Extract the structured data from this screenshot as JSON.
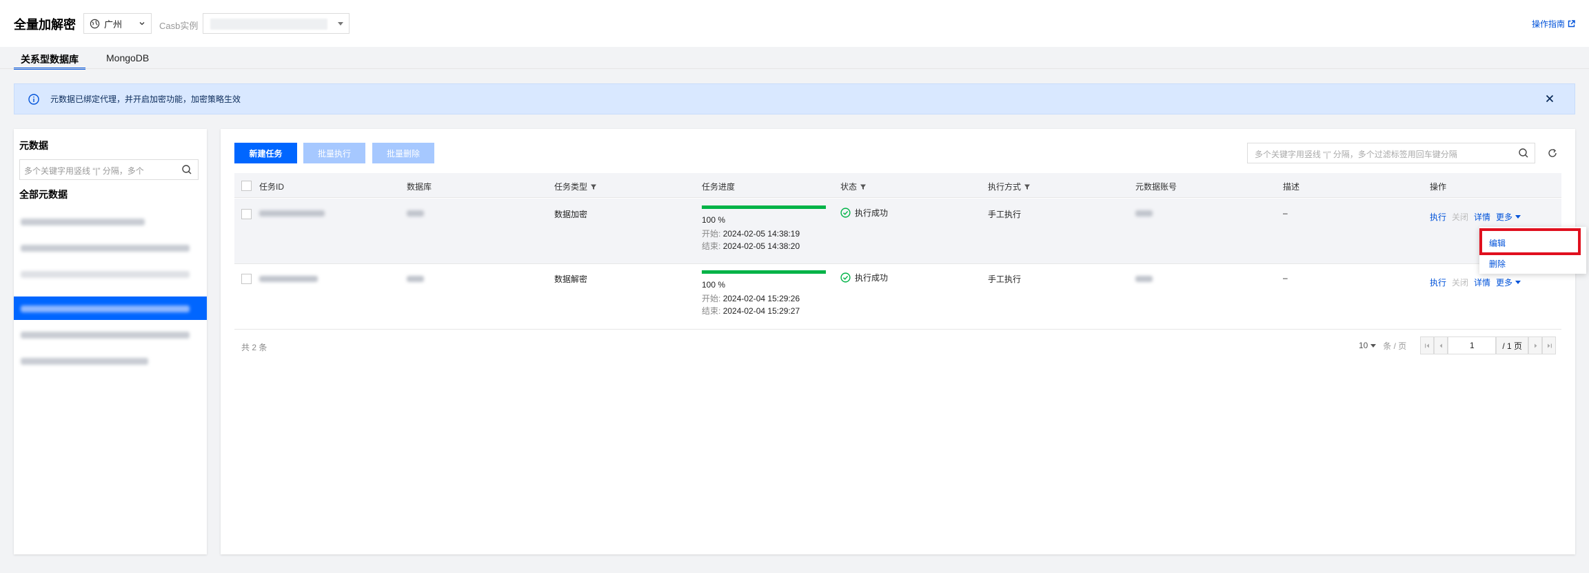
{
  "header": {
    "title": "全量加解密",
    "region": "广州",
    "casb_label": "Casb实例",
    "guide_link": "操作指南"
  },
  "tabs": [
    {
      "label": "关系型数据库",
      "active": true
    },
    {
      "label": "MongoDB",
      "active": false
    }
  ],
  "notice": {
    "text": "元数据已绑定代理，并开启加密功能，加密策略生效"
  },
  "left_panel": {
    "title": "元数据",
    "search_placeholder": "多个关键字用竖线 “|” 分隔，多个",
    "all_label": "全部元数据"
  },
  "toolbar": {
    "new_task": "新建任务",
    "batch_execute": "批量执行",
    "batch_delete": "批量删除",
    "search_placeholder": "多个关键字用竖线 “|” 分隔，多个过滤标签用回车键分隔"
  },
  "table": {
    "headers": {
      "task_id": "任务ID",
      "database": "数据库",
      "task_type": "任务类型",
      "progress": "任务进度",
      "status": "状态",
      "exec_mode": "执行方式",
      "meta_account": "元数据账号",
      "description": "描述",
      "operations": "操作"
    },
    "rows": [
      {
        "task_type": "数据加密",
        "progress_pct": 100,
        "progress_text": "100 %",
        "start_label": "开始:",
        "start_time": "2024-02-05 14:38:19",
        "end_label": "结束:",
        "end_time": "2024-02-05 14:38:20",
        "status": "执行成功",
        "exec_mode": "手工执行",
        "description": "–"
      },
      {
        "task_type": "数据解密",
        "progress_pct": 100,
        "progress_text": "100 %",
        "start_label": "开始:",
        "start_time": "2024-02-04 15:29:26",
        "end_label": "结束:",
        "end_time": "2024-02-04 15:29:27",
        "status": "执行成功",
        "exec_mode": "手工执行",
        "description": "–"
      }
    ],
    "ops": {
      "execute": "执行",
      "close": "关闭",
      "detail": "详情",
      "more": "更多"
    }
  },
  "pagination": {
    "total_text": "共 2 条",
    "page_size": "10",
    "page_size_unit": "条 / 页",
    "current_page": "1",
    "total_pages": "/ 1 页"
  },
  "dropdown_menu": {
    "edit": "编辑",
    "delete": "删除"
  },
  "colors": {
    "primary": "#0066ff",
    "link": "#0052d9",
    "success": "#00b347",
    "highlight": "#e0101e"
  }
}
